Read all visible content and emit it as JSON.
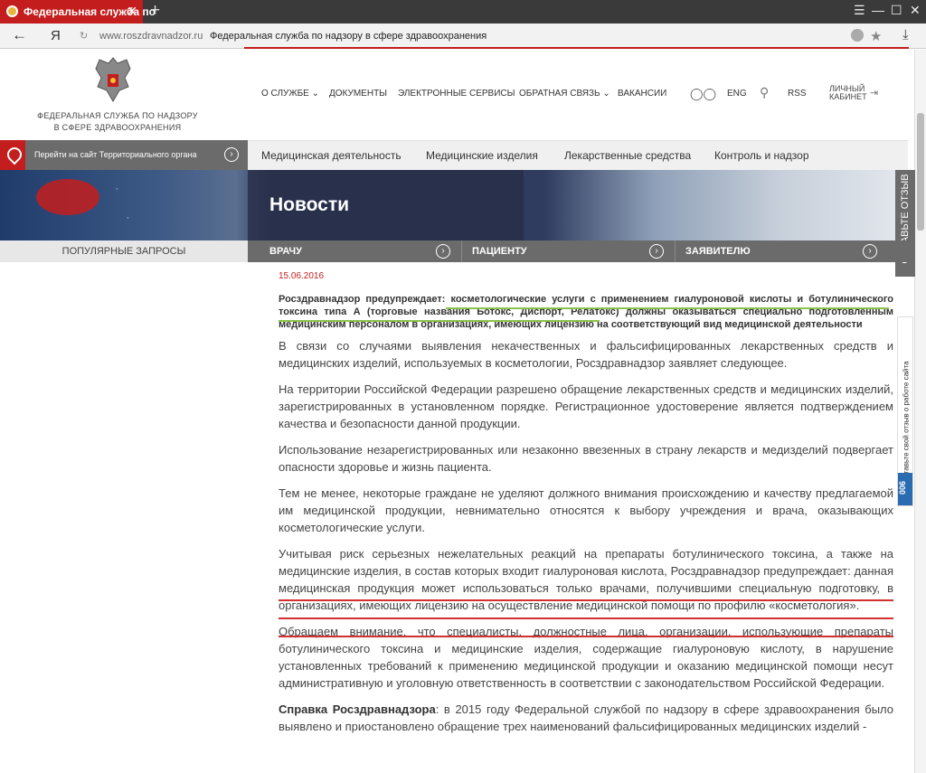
{
  "browser": {
    "tab_title": "Федеральная служба по",
    "tab_close": "✕",
    "new_tab": "+",
    "back": "←",
    "yandex": "Я",
    "url": "www.roszdravnadzor.ru",
    "page_title": "Федеральная служба по надзору в сфере здравоохранения",
    "win_menu": "☰",
    "win_minimize": "—",
    "win_maximize": "☐",
    "win_close": "✕"
  },
  "site": {
    "org_line1": "ФЕДЕРАЛЬНАЯ СЛУЖБА ПО НАДЗОРУ",
    "org_line2": "В СФЕРЕ ЗДРАВООХРАНЕНИЯ",
    "top_nav": [
      "О СЛУЖБЕ ⌄",
      "ДОКУМЕНТЫ",
      "ЭЛЕКТРОННЫЕ СЕРВИСЫ",
      "ОБРАТНАЯ СВЯЗЬ ⌄",
      "ВАКАНСИИ"
    ],
    "lang": "ENG",
    "rss": "RSS",
    "cabinet_line1": "ЛИЧНЫЙ",
    "cabinet_line2": "КАБИНЕТ",
    "territorial_link": "Перейти на сайт Территориального органа",
    "categories": [
      "Медицинская деятельность",
      "Медицинские изделия",
      "Лекарственные средства",
      "Контроль и надзор"
    ],
    "banner_title": "Новости",
    "popular": "ПОПУЛЯРНЫЕ ЗАПРОСЫ",
    "sub_nav": [
      "ВРАЧУ",
      "ПАЦИЕНТУ",
      "ЗАЯВИТЕЛЮ"
    ],
    "feedback_tab": "ОСТАВЬТЕ ОТЗЫВ",
    "side_widget": "Оставьте свой отзыв о работе сайта",
    "side_badge": "006"
  },
  "article": {
    "date": "15.06.2016",
    "lead": "Росздравнадзор предупреждает: косметологические услуги с применением гиалуроновой кислоты и ботулинического токсина типа А (торговые названия Ботокс, Диспорт, Релатокс) должны оказываться специально подготовленным медицинским персоналом в организациях, имеющих лицензию на соответствующий вид медицинской деятельности",
    "paragraphs": [
      "В связи со случаями выявления некачественных и фальсифицированных лекарственных средств и медицинских изделий, используемых в косметологии, Росздравнадзор заявляет следующее.",
      "На территории Российской Федерации разрешено обращение лекарственных средств и  медицинских изделий, зарегистрированных в установленном порядке. Регистрационное удостоверение является подтверждением качества и безопасности данной продукции.",
      "Использование незарегистрированных или незаконно ввезенных в страну лекарств и медизделий подвергает опасности здоровье и жизнь пациента.",
      "Тем не менее, некоторые граждане не уделяют должного внимания происхождению и качеству предлагаемой  им медицинской продукции, невнимательно  относятся к выбору учреждения и врача, оказывающих косметологические услуги.",
      "Учитывая риск серьезных нежелательных реакций на препараты ботулинического токсина, а также на медицинские изделия, в состав которых входит гиалуроновая кислота, Росздравнадзор предупреждает: данная медицинская продукция может  использоваться только врачами, получившими специальную подготовку, в организациях, имеющих лицензию на осуществление  медицинской помощи по профилю «косметология».",
      "Обращаем внимание, что специалисты, должностные лица, организации, использующие препараты ботулинического токсина и медицинские изделия, содержащие гиалуроновую кислоту, в нарушение установленных требований к применению медицинской продукции  и оказанию медицинской помощи несут административную и уголовную ответственность в соответствии с законодательством Российской Федерации."
    ],
    "ref_label": "Справка Росздравнадзора",
    "ref_text": ": в 2015 году Федеральной службой по надзору в  сфере здравоохранения было выявлено и приостановлено обращение трех наименований фальсифицированных медицинских изделий -"
  },
  "colors": {
    "brand_red": "#c41d1d",
    "highlight_green": "#8bc34a",
    "highlight_red": "#d32f2f"
  }
}
